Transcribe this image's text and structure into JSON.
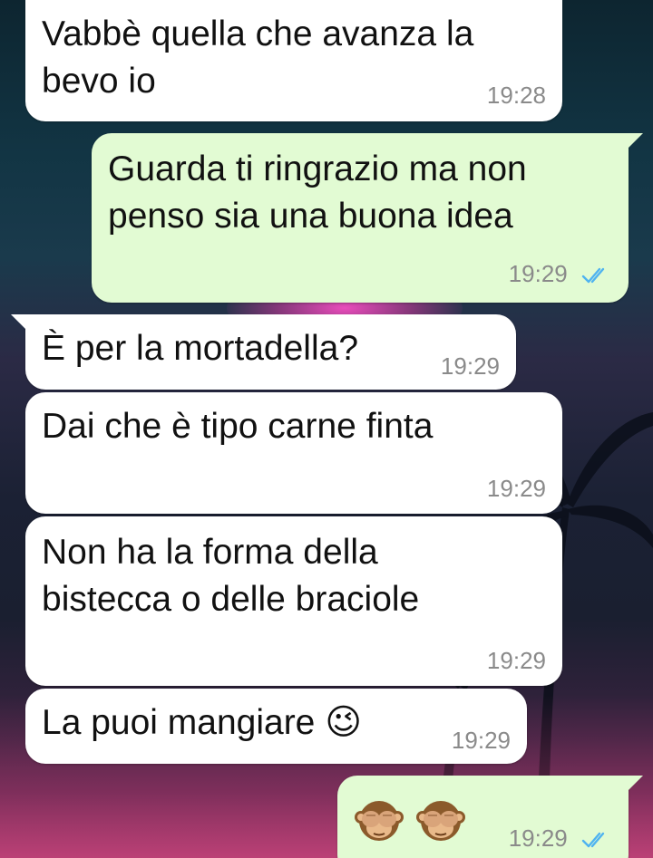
{
  "messages": [
    {
      "id": "m1",
      "direction": "incoming",
      "text": "Vabbè quella che avanza la\nbevo io",
      "time": "19:28"
    },
    {
      "id": "m2",
      "direction": "outgoing",
      "text": "Guarda ti ringrazio ma non\npenso sia una buona idea",
      "time": "19:29",
      "status": "read"
    },
    {
      "id": "m3",
      "direction": "incoming",
      "text": "È per la mortadella?",
      "time": "19:29"
    },
    {
      "id": "m4",
      "direction": "incoming",
      "text": "Dai che è tipo carne finta",
      "time": "19:29"
    },
    {
      "id": "m5",
      "direction": "incoming",
      "text": "Non ha la forma della\nbistecca o delle braciole",
      "time": "19:29"
    },
    {
      "id": "m6",
      "direction": "incoming",
      "text": "La puoi mangiare 😉",
      "time": "19:29"
    },
    {
      "id": "m7",
      "direction": "outgoing",
      "emoji": [
        "see-no-evil-monkey",
        "see-no-evil-monkey"
      ],
      "time": "19:29",
      "status": "read"
    }
  ],
  "colors": {
    "incoming_bubble": "#ffffff",
    "outgoing_bubble": "#e2fbd3",
    "timestamp": "#8a8a8a",
    "read_ticks": "#4fb3f0"
  }
}
